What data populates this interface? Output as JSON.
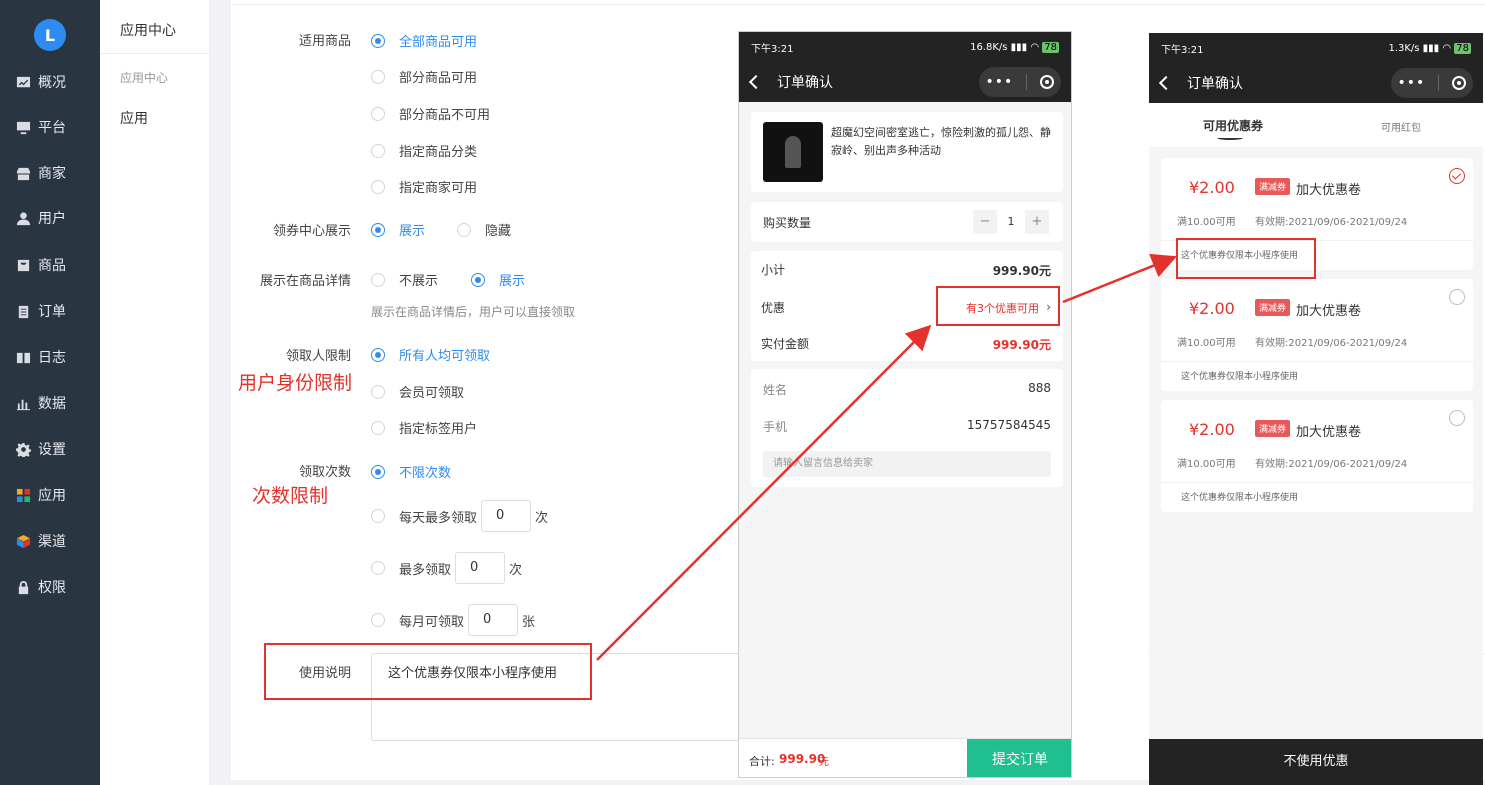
{
  "sidebar": {
    "logo": "L",
    "items": [
      {
        "label": "概况",
        "icon": "chart-icon"
      },
      {
        "label": "平台",
        "icon": "monitor-icon"
      },
      {
        "label": "商家",
        "icon": "store-icon"
      },
      {
        "label": "用户",
        "icon": "user-icon"
      },
      {
        "label": "商品",
        "icon": "bag-icon"
      },
      {
        "label": "订单",
        "icon": "clipboard-icon"
      },
      {
        "label": "日志",
        "icon": "book-icon"
      },
      {
        "label": "数据",
        "icon": "bar-chart-icon"
      },
      {
        "label": "设置",
        "icon": "gear-icon"
      },
      {
        "label": "应用",
        "icon": "apps-icon"
      },
      {
        "label": "渠道",
        "icon": "cube-icon"
      },
      {
        "label": "权限",
        "icon": "lock-icon"
      }
    ]
  },
  "subbar": {
    "title": "应用中心",
    "group": "应用中心",
    "item": "应用"
  },
  "form": {
    "scope_label": "适用商品",
    "scope_options": [
      "全部商品可用",
      "部分商品可用",
      "部分商品不可用",
      "指定商品分类",
      "指定商家可用"
    ],
    "center_label": "领券中心展示",
    "center_options": [
      "展示",
      "隐藏"
    ],
    "detail_label": "展示在商品详情",
    "detail_options": [
      "不展示",
      "展示"
    ],
    "detail_hint": "展示在商品详情后，用户可以直接领取",
    "who_label": "领取人限制",
    "who_options": [
      "所有人均可领取",
      "会员可领取",
      "指定标签用户"
    ],
    "who_note": "用户身份限制",
    "times_label": "领取次数",
    "times_options": [
      "不限次数",
      "每天最多领取",
      "最多领取",
      "每月可领取"
    ],
    "times_values": [
      "0",
      "0",
      "0"
    ],
    "times_units": [
      "次",
      "次",
      "张"
    ],
    "times_note": "次数限制",
    "desc_label": "使用说明",
    "desc_value": "这个优惠券仅限本小程序使用"
  },
  "phone1": {
    "time": "下午3:21",
    "net": "16.8K/s",
    "battery": "78",
    "title": "订单确认",
    "product_name": "超魔幻空间密室逃亡，惊险刺激的孤儿怨、静寂岭、别出声多种活动",
    "qty_label": "购买数量",
    "qty_minus": "−",
    "qty": "1",
    "qty_plus": "+",
    "subtotal_label": "小计",
    "subtotal": "999.90元",
    "discount_label": "优惠",
    "discount": "有3个优惠可用",
    "pay_label": "实付金额",
    "pay": "999.90元",
    "name_label": "姓名",
    "name": "888",
    "phone_label": "手机",
    "phone": "15757584545",
    "msg_placeholder": "请输入留言信息给卖家",
    "total_label": "合计:",
    "total": "999.90",
    "total_unit": "元",
    "submit": "提交订单"
  },
  "phone2": {
    "time": "下午3:21",
    "net": "1.3K/s",
    "battery": "78",
    "title": "订单确认",
    "tabs": [
      "可用优惠券",
      "可用红包"
    ],
    "coupons": [
      {
        "price": "¥2.00",
        "tag": "满减券",
        "name": "加大优惠卷",
        "cond": "满10.00可用",
        "valid": "有效期:2021/09/06-2021/09/24",
        "desc": "这个优惠券仅限本小程序使用",
        "checked": true
      },
      {
        "price": "¥2.00",
        "tag": "满减券",
        "name": "加大优惠卷",
        "cond": "满10.00可用",
        "valid": "有效期:2021/09/06-2021/09/24",
        "desc": "这个优惠券仅限本小程序使用",
        "checked": false
      },
      {
        "price": "¥2.00",
        "tag": "满减券",
        "name": "加大优惠卷",
        "cond": "满10.00可用",
        "valid": "有效期:2021/09/06-2021/09/24",
        "desc": "这个优惠券仅限本小程序使用",
        "checked": false
      }
    ],
    "no_coupon": "不使用优惠"
  },
  "colors": {
    "accent": "#2d8cf0",
    "annotation": "#e4312c",
    "submit": "#1fbf8f"
  }
}
